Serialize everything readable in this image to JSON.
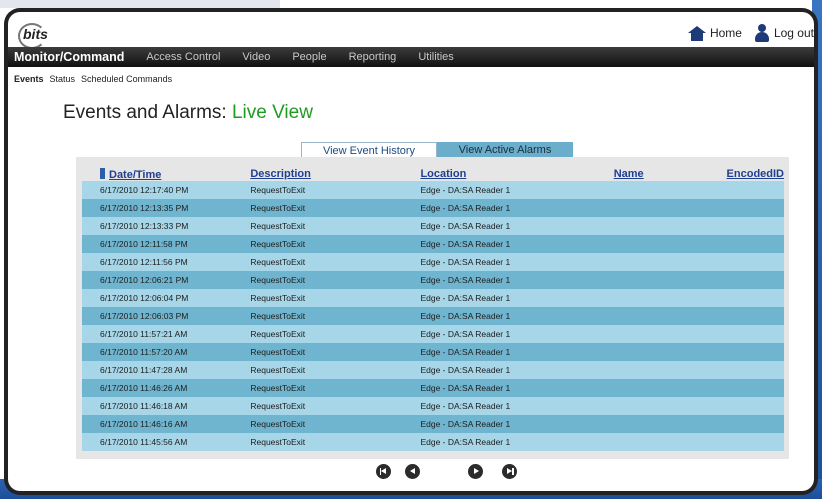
{
  "header": {
    "logo_text": "bits",
    "home_label": "Home",
    "logout_label": "Log out"
  },
  "nav": [
    {
      "label": "Monitor/Command",
      "active": true
    },
    {
      "label": "Access Control"
    },
    {
      "label": "Video"
    },
    {
      "label": "People"
    },
    {
      "label": "Reporting"
    },
    {
      "label": "Utilities"
    }
  ],
  "subnav": [
    {
      "label": "Events",
      "active": true
    },
    {
      "label": "Status"
    },
    {
      "label": "Scheduled Commands"
    }
  ],
  "page": {
    "title_prefix": "Events and Alarms: ",
    "title_highlight": "Live View"
  },
  "tabs": {
    "history": "View Event History",
    "alarms": "View Active Alarms"
  },
  "table": {
    "columns": [
      "Date/Time",
      "Description",
      "Location",
      "Name",
      "EncodedID"
    ],
    "rows": [
      [
        "6/17/2010 12:17:40 PM",
        "RequestToExit",
        "Edge - DA:SA Reader 1",
        "",
        ""
      ],
      [
        "6/17/2010 12:13:35 PM",
        "RequestToExit",
        "Edge - DA:SA Reader 1",
        "",
        ""
      ],
      [
        "6/17/2010 12:13:33 PM",
        "RequestToExit",
        "Edge - DA:SA Reader 1",
        "",
        ""
      ],
      [
        "6/17/2010 12:11:58 PM",
        "RequestToExit",
        "Edge - DA:SA Reader 1",
        "",
        ""
      ],
      [
        "6/17/2010 12:11:56 PM",
        "RequestToExit",
        "Edge - DA:SA Reader 1",
        "",
        ""
      ],
      [
        "6/17/2010 12:06:21 PM",
        "RequestToExit",
        "Edge - DA:SA Reader 1",
        "",
        ""
      ],
      [
        "6/17/2010 12:06:04 PM",
        "RequestToExit",
        "Edge - DA:SA Reader 1",
        "",
        ""
      ],
      [
        "6/17/2010 12:06:03 PM",
        "RequestToExit",
        "Edge - DA:SA Reader 1",
        "",
        ""
      ],
      [
        "6/17/2010 11:57:21 AM",
        "RequestToExit",
        "Edge - DA:SA Reader 1",
        "",
        ""
      ],
      [
        "6/17/2010 11:57:20 AM",
        "RequestToExit",
        "Edge - DA:SA Reader 1",
        "",
        ""
      ],
      [
        "6/17/2010 11:47:28 AM",
        "RequestToExit",
        "Edge - DA:SA Reader 1",
        "",
        ""
      ],
      [
        "6/17/2010 11:46:26 AM",
        "RequestToExit",
        "Edge - DA:SA Reader 1",
        "",
        ""
      ],
      [
        "6/17/2010 11:46:18 AM",
        "RequestToExit",
        "Edge - DA:SA Reader 1",
        "",
        ""
      ],
      [
        "6/17/2010 11:46:16 AM",
        "RequestToExit",
        "Edge - DA:SA Reader 1",
        "",
        ""
      ],
      [
        "6/17/2010 11:45:56 AM",
        "RequestToExit",
        "Edge - DA:SA Reader 1",
        "",
        ""
      ]
    ]
  },
  "pager": {
    "buttons": [
      "first-page-icon",
      "previous-page-icon",
      "next-page-icon",
      "last-page-icon"
    ]
  },
  "colors": {
    "row_light": "#a6d6e8",
    "row_dark": "#6fb5cf",
    "active_tab": "#6aaecb",
    "title_highlight": "#1e9c22",
    "header_link": "#1f3f90"
  }
}
